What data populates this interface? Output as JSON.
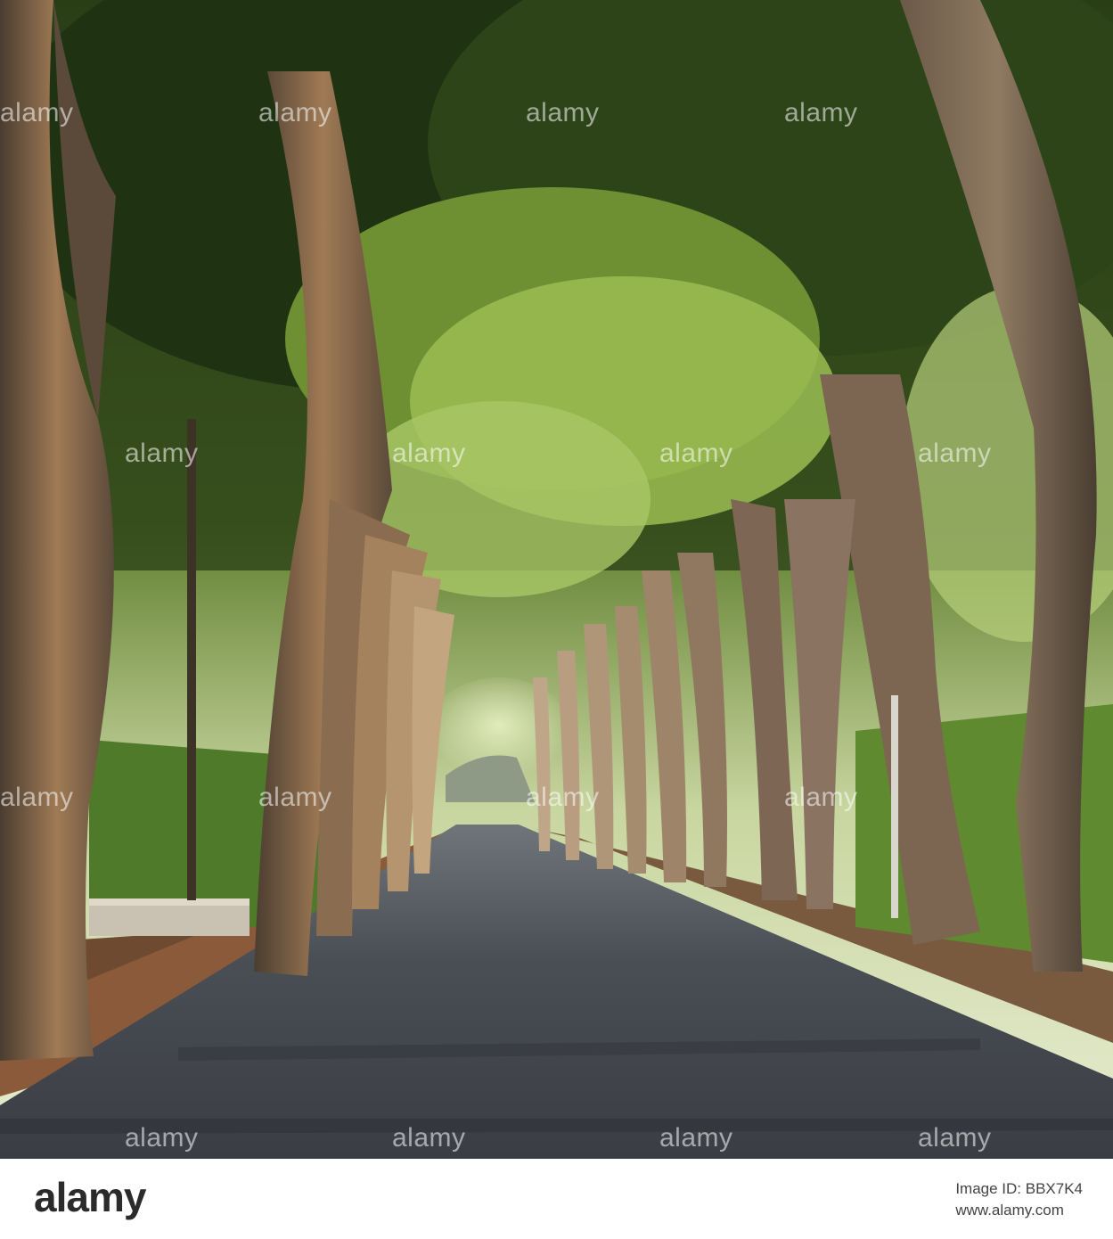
{
  "watermark": {
    "text": "alamy"
  },
  "footer": {
    "logo": "alamy",
    "image_id_label": "Image ID: BBX7K4",
    "site": "www.alamy.com"
  },
  "colors": {
    "canopy_dark": "#1f3313",
    "canopy_light": "#9bbd52",
    "trunk": "#6b5a45",
    "road": "#3a3d42",
    "verge": "#6d4a30"
  }
}
